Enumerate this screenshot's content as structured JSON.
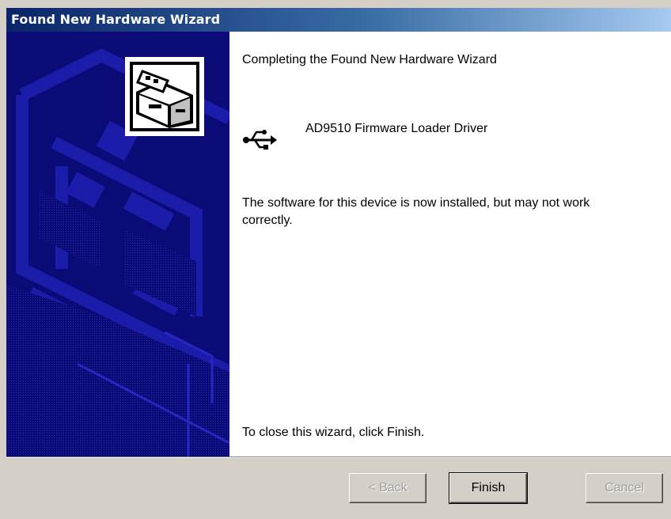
{
  "window": {
    "title": "Found New Hardware Wizard"
  },
  "main": {
    "heading": "Completing the Found New Hardware Wizard",
    "device_name": "AD9510 Firmware Loader Driver",
    "message": "The software for this device is now installed, but may not work correctly.",
    "close_hint": "To close this wizard, click Finish."
  },
  "buttons": {
    "back_label": "< Back",
    "finish_label": "Finish",
    "cancel_label": "Cancel"
  },
  "icons": {
    "wizard": "hardware-wizard-icon",
    "device": "usb-icon"
  },
  "colors": {
    "title_start": "#0a246a",
    "title_end": "#a6caf0",
    "side_panel": "#0b0b78",
    "face": "#d4d0c8"
  }
}
